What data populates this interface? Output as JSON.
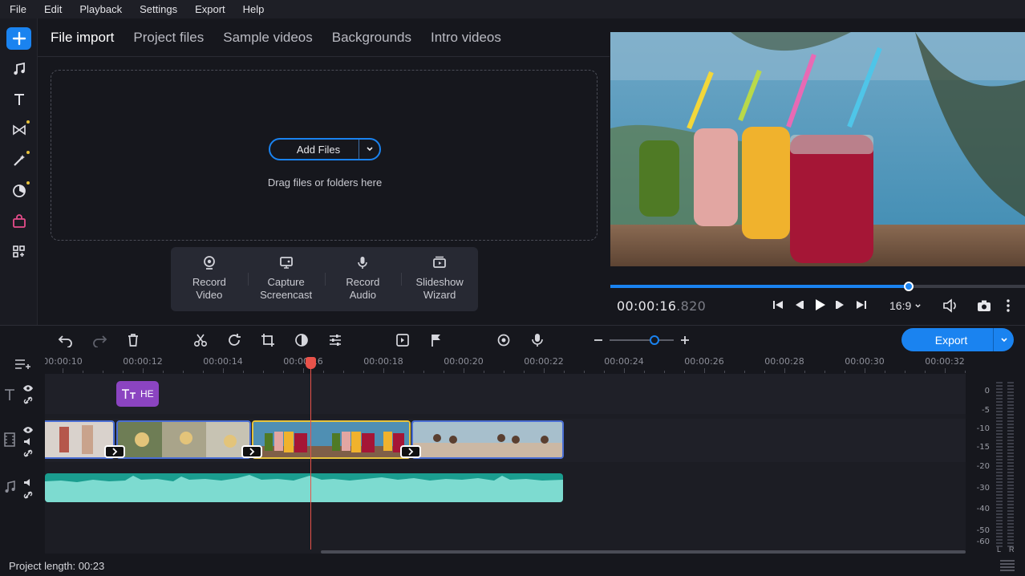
{
  "menu": [
    "File",
    "Edit",
    "Playback",
    "Settings",
    "Export",
    "Help"
  ],
  "import_tabs": [
    "File import",
    "Project files",
    "Sample videos",
    "Backgrounds",
    "Intro videos"
  ],
  "import": {
    "add_files_label": "Add Files",
    "drag_hint": "Drag files or folders here",
    "record": [
      {
        "line1": "Record",
        "line2": "Video",
        "icon": "webcam-icon"
      },
      {
        "line1": "Capture",
        "line2": "Screencast",
        "icon": "monitor-icon"
      },
      {
        "line1": "Record",
        "line2": "Audio",
        "icon": "microphone-icon"
      },
      {
        "line1": "Slideshow",
        "line2": "Wizard",
        "icon": "slideshow-icon"
      }
    ]
  },
  "player": {
    "time_main": "00:00:16",
    "time_frac": ".820",
    "aspect": "16:9",
    "progress_fraction": 0.72
  },
  "toolbar": {
    "export_label": "Export",
    "zoom_level_fraction": 0.7
  },
  "timeline": {
    "ticks": [
      "00:00:10",
      "00:00:12",
      "00:00:14",
      "00:00:16",
      "00:00:18",
      "00:00:20",
      "00:00:22",
      "00:00:24",
      "00:00:26",
      "00:00:28",
      "00:00:30",
      "00:00:32"
    ],
    "title_clip_text": "HE",
    "db_scale": [
      "0",
      "-5",
      "-10",
      "-15",
      "-20",
      "-30",
      "-40",
      "-50",
      "-60"
    ],
    "meter_left": "L",
    "meter_right": "R"
  },
  "status": {
    "project_length": "Project length: 00:23"
  },
  "colors": {
    "accent": "#1a83f0",
    "title_clip": "#8b44c1",
    "audio_clip": "#1a9d8f",
    "selected_clip_border": "#e7c33b",
    "playhead": "#e8524a",
    "rail_dot": "#e8c23a"
  }
}
